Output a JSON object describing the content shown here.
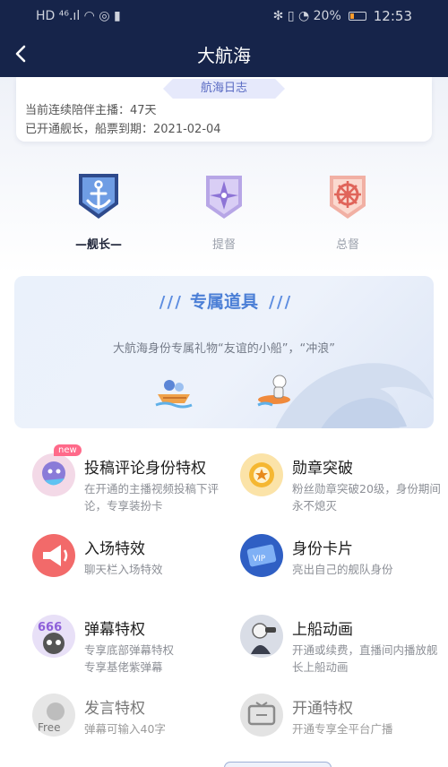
{
  "status_bar": {
    "left": "HD ⁴⁶.ıl ◠ ◎ ▮",
    "right": "✻ ▯ ◔ 20%",
    "time": "12:53"
  },
  "header": {
    "title": "大航海",
    "back_icon": "back-arrow-icon"
  },
  "log": {
    "tag": "航海日志",
    "line1": "当前连续陪伴主播：47天",
    "line2": "已开通舰长，船票到期：2021-02-04"
  },
  "ranks": [
    {
      "label": "舰长",
      "active": true,
      "icon": "anchor-badge-icon"
    },
    {
      "label": "提督",
      "active": false,
      "icon": "compass-badge-icon"
    },
    {
      "label": "总督",
      "active": false,
      "icon": "ship-wheel-badge-icon"
    }
  ],
  "exclusive_props": {
    "title": "专属道具",
    "description": "大航海身份专属礼物“友谊的小船”，“冲浪”",
    "items": [
      "boat-gift-icon",
      "surf-gift-icon"
    ]
  },
  "privileges": [
    {
      "name": "投稿评论身份特权",
      "desc": "在开通的主播视频投稿下评论，专享装扮卡",
      "badge": "new"
    },
    {
      "name": "勋章突破",
      "desc": "粉丝勋章突破20级，身份期间永不熄灭"
    },
    {
      "name": "入场特效",
      "desc": "聊天栏入场特效"
    },
    {
      "name": "身份卡片",
      "desc": "亮出自己的舰队身份"
    },
    {
      "name": "弹幕特权",
      "desc": "专享底部弹幕特权\n专享基佬紫弹幕"
    },
    {
      "name": "上船动画",
      "desc": "开通或续费，直播间内播放舰长上船动画"
    },
    {
      "name": "发言特权",
      "desc": "弹幕可输入40字"
    },
    {
      "name": "开通特权",
      "desc": "开通专享全平台广播"
    }
  ],
  "colors": {
    "nav_bg": "#16244a",
    "accent": "#4b7fd6",
    "tag_bg": "#e6e9fb"
  }
}
